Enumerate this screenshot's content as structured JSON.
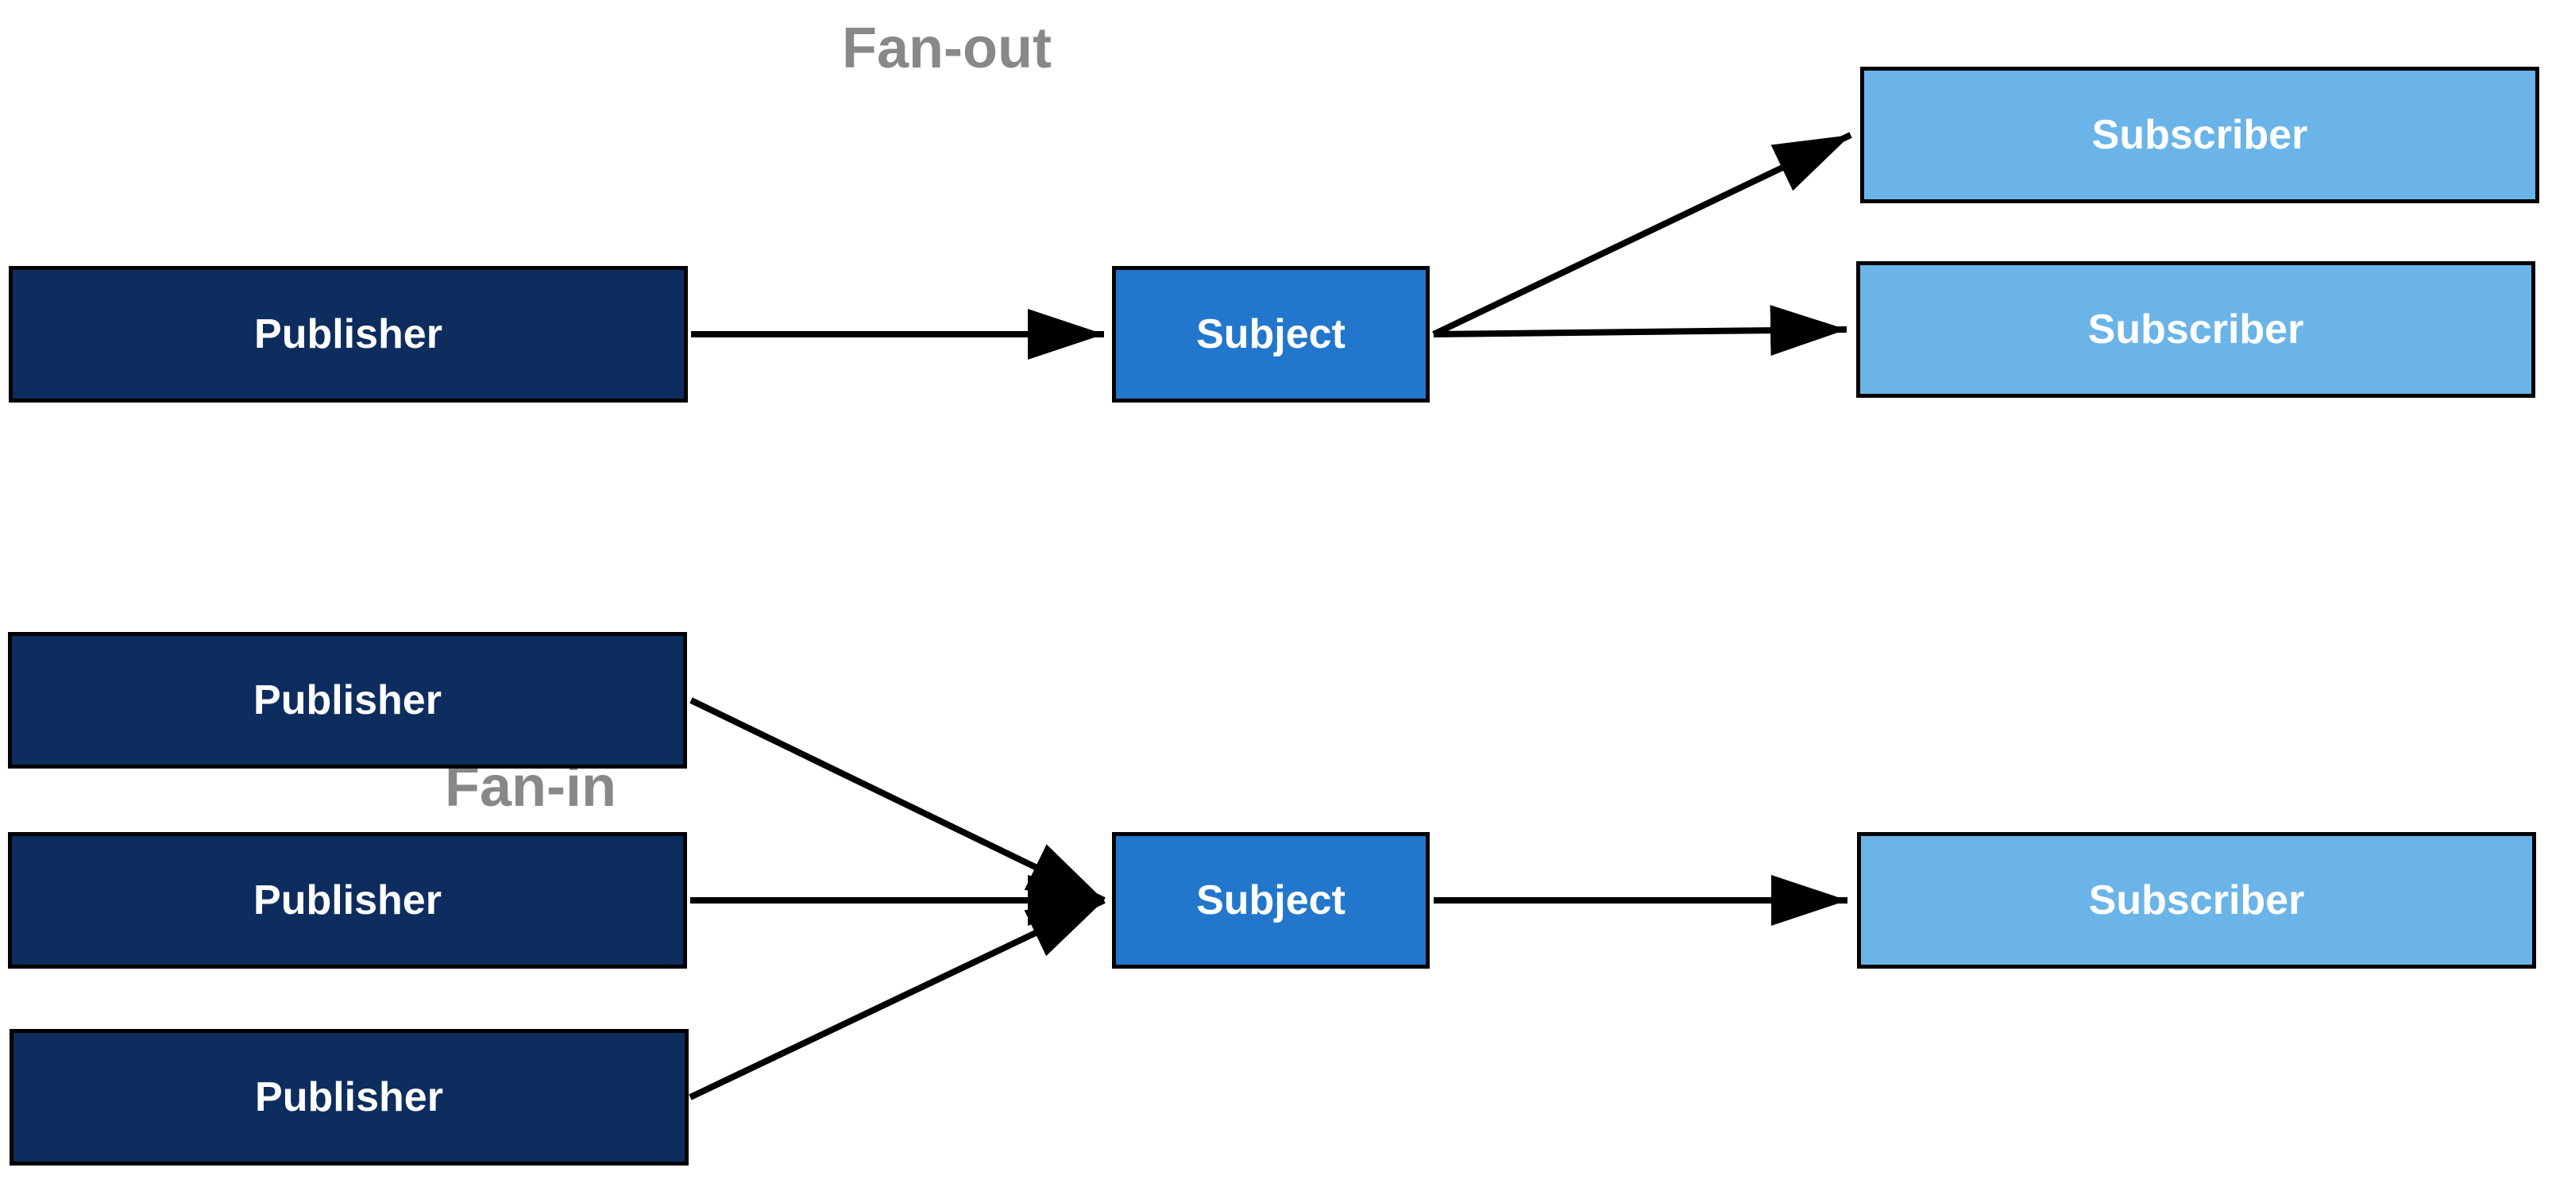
{
  "diagrams": {
    "fanout": {
      "label": "Fan-out",
      "publisher": "Publisher",
      "subject": "Subject",
      "subscribers": [
        "Subscriber",
        "Subscriber"
      ]
    },
    "fanin": {
      "label": "Fan-in",
      "publishers": [
        "Publisher",
        "Publisher",
        "Publisher"
      ],
      "subject": "Subject",
      "subscriber": "Subscriber"
    }
  }
}
